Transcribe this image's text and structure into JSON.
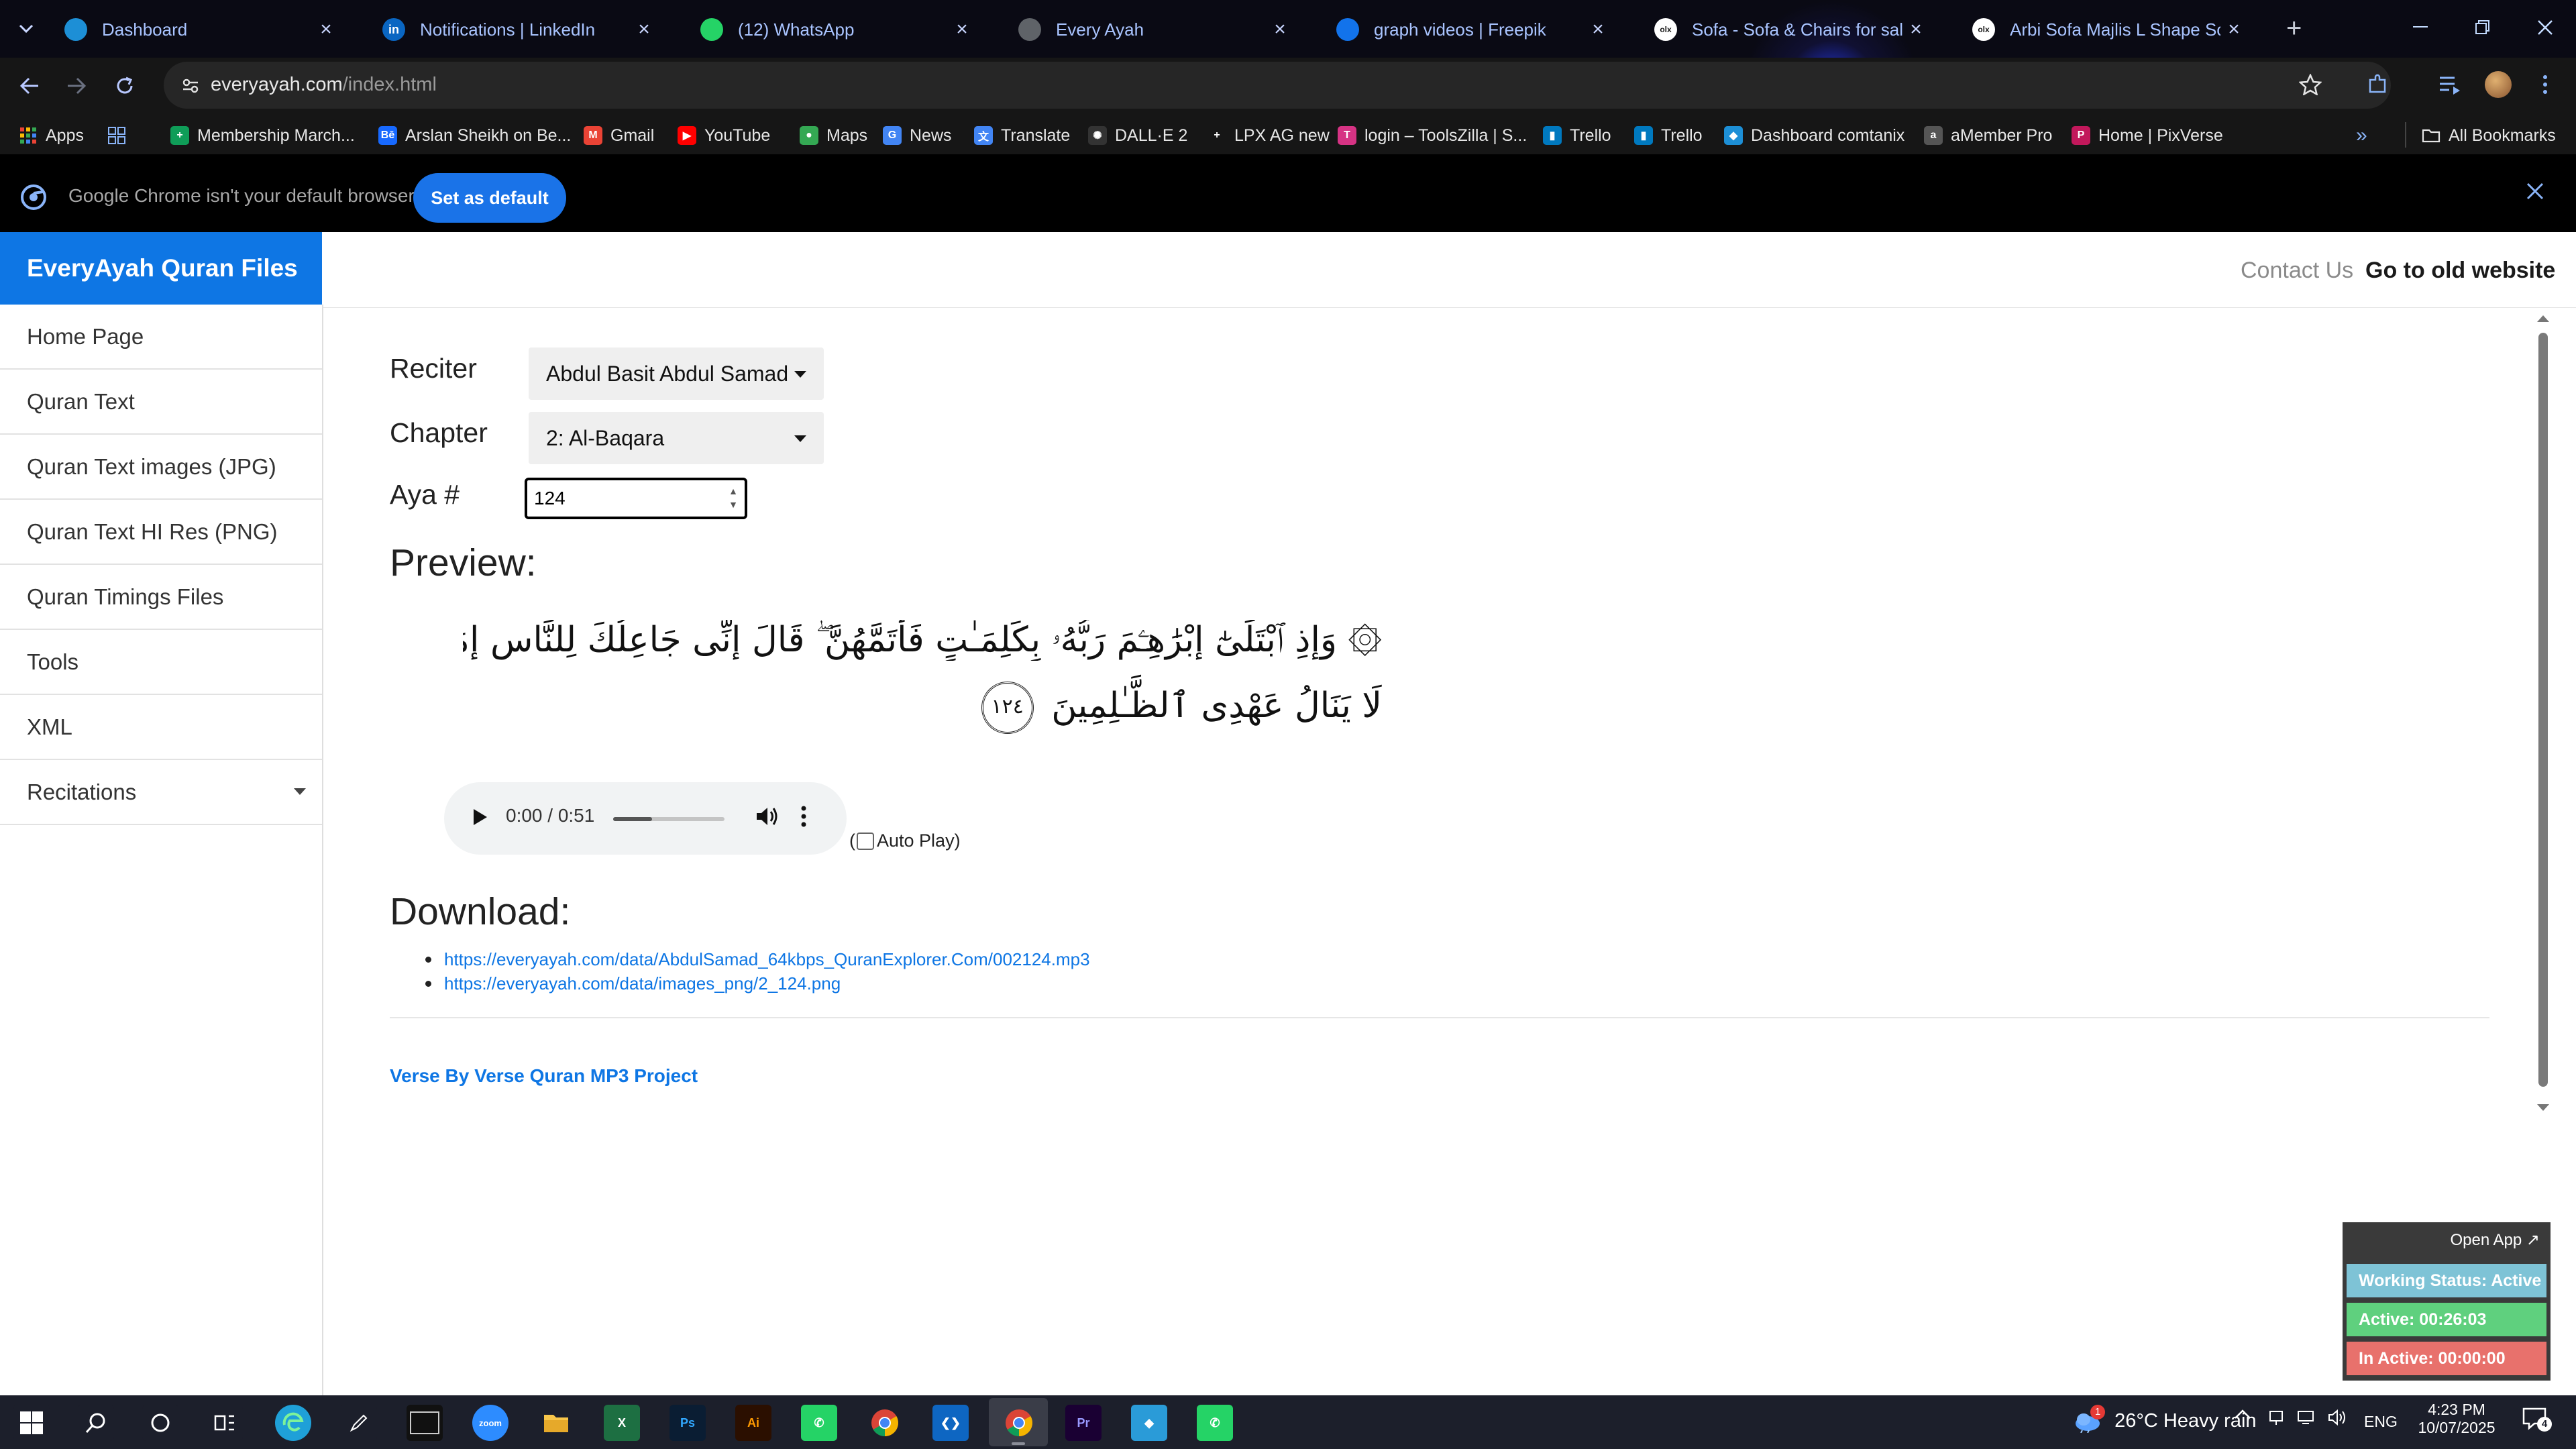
{
  "browser": {
    "tabs": [
      {
        "title": "Dashboard",
        "icon": "dashboard-favicon",
        "color": "#1d8fd6"
      },
      {
        "title": "Notifications | LinkedIn",
        "icon": "linkedin-favicon",
        "color": "#0a66c2",
        "glyph": "in"
      },
      {
        "title": "(12) WhatsApp",
        "icon": "whatsapp-favicon",
        "color": "#25d366"
      },
      {
        "title": "Every Ayah",
        "icon": "globe-favicon",
        "color": "#5f6368"
      },
      {
        "title": "graph videos | Freepik",
        "icon": "freepik-favicon",
        "color": "#1273eb"
      },
      {
        "title": "Sofa - Sofa & Chairs for sale in",
        "icon": "olx-favicon",
        "color": "#ffffff",
        "glyph": "olx"
      },
      {
        "title": "Arbi Sofa Majlis L Shape Sofa -",
        "icon": "olx-favicon",
        "color": "#ffffff",
        "glyph": "olx"
      }
    ],
    "url_host": "everyayah.com",
    "url_path": "/index.html",
    "bookmarks": [
      {
        "label": "Apps",
        "icon": "apps-grid-icon",
        "color": "#4285f4"
      },
      {
        "label": "",
        "icon": "tab-groups-icon",
        "color": "#8ab4f8"
      },
      {
        "label": "Membership March...",
        "icon": "plus-square-icon",
        "color": "#0f9d58"
      },
      {
        "label": "Arslan Sheikh on Be...",
        "icon": "behance-icon",
        "color": "#1769ff",
        "glyph": "Bē"
      },
      {
        "label": "Gmail",
        "icon": "gmail-icon",
        "color": "#ea4335",
        "glyph": "M"
      },
      {
        "label": "YouTube",
        "icon": "youtube-icon",
        "color": "#ff0000",
        "glyph": "▶"
      },
      {
        "label": "Maps",
        "icon": "maps-icon",
        "color": "#34a853",
        "glyph": "●"
      },
      {
        "label": "News",
        "icon": "news-icon",
        "color": "#4285f4",
        "glyph": "G"
      },
      {
        "label": "Translate",
        "icon": "translate-icon",
        "color": "#4285f4",
        "glyph": "文"
      },
      {
        "label": "DALL·E 2",
        "icon": "openai-icon",
        "color": "#333333",
        "glyph": "✺"
      },
      {
        "label": "LPX AG new",
        "icon": "blank-icon",
        "color": "#161616",
        "glyph": ""
      },
      {
        "label": "login – ToolsZilla | S...",
        "icon": "toolszilla-icon",
        "color": "#d63384",
        "glyph": "T"
      },
      {
        "label": "Trello",
        "icon": "trello-icon",
        "color": "#0079bf",
        "glyph": "▮"
      },
      {
        "label": "Trello",
        "icon": "trello-icon",
        "color": "#0079bf",
        "glyph": "▮"
      },
      {
        "label": "Dashboard comtanix",
        "icon": "dashboard-favicon",
        "color": "#1d8fd6",
        "glyph": "◆"
      },
      {
        "label": "aMember Pro",
        "icon": "amember-icon",
        "color": "#555555",
        "glyph": "a"
      },
      {
        "label": "Home | PixVerse",
        "icon": "pixverse-icon",
        "color": "#c2185b",
        "glyph": "P"
      }
    ],
    "bookmarks_overflow": "»",
    "all_bookmarks": "All Bookmarks",
    "infobar_text": "Google Chrome isn't your default browser",
    "infobar_button": "Set as default"
  },
  "site": {
    "brand": "EveryAyah Quran Files",
    "nav": {
      "contact": "Contact Us",
      "old_site": "Go to old website"
    },
    "sidebar": [
      {
        "label": "Home Page"
      },
      {
        "label": "Quran Text"
      },
      {
        "label": "Quran Text images (JPG)"
      },
      {
        "label": "Quran Text HI Res (PNG)"
      },
      {
        "label": "Quran Timings Files"
      },
      {
        "label": "Tools"
      },
      {
        "label": "XML"
      },
      {
        "label": "Recitations",
        "dropdown": true
      }
    ],
    "form": {
      "reciter_label": "Reciter",
      "reciter_value": "Abdul Basit Abdul Samad",
      "chapter_label": "Chapter",
      "chapter_value": "2: Al-Baqara",
      "aya_label": "Aya #",
      "aya_value": "124"
    },
    "preview_heading": "Preview:",
    "verse_line1": "۞ وَإِذِ ٱبْتَلَىٰٓ إِبْرَٰهِـۧمَ رَبُّهُۥ بِكَلِمَـٰتٍ فَأَتَمَّهُنَّ ۖ قَالَ إِنِّى جَاعِلُكَ لِلنَّاسِ إِمَامًا ۖ قَالَ وَمِن ذُرِّيَّتِى ۖ قَالَ",
    "verse_line2": "لَا يَنَالُ عَهْدِى ٱلظَّـٰلِمِينَ",
    "verse_number": "١٢٤",
    "audio": {
      "time": "0:00 / 0:51",
      "progress": 0.0
    },
    "autoplay_open": "(",
    "autoplay_label": "Auto Play)",
    "download_heading": "Download:",
    "downloads": [
      "https://everyayah.com/data/AbdulSamad_64kbps_QuranExplorer.Com/002124.mp3",
      "https://everyayah.com/data/images_png/2_124.png"
    ],
    "footer": "Verse By Verse Quran MP3 Project"
  },
  "widget": {
    "open": "Open App ↗",
    "status": "Working Status: Active",
    "active": "Active: 00:26:03",
    "inactive": "In Active: 00:00:00",
    "colors": {
      "status": "#7ec3d6",
      "active": "#5fd07e",
      "inactive": "#e8716c"
    }
  },
  "taskbar": {
    "apps": [
      {
        "icon": "windows-start-icon",
        "color": "#1c1f2b"
      },
      {
        "icon": "search-icon",
        "color": "#1c1f2b"
      },
      {
        "icon": "cortana-icon",
        "color": "#1c1f2b"
      },
      {
        "icon": "task-view-icon",
        "color": "#1c1f2b"
      },
      {
        "icon": "edge-icon",
        "color": "#1fa0d8"
      },
      {
        "icon": "pen-icon",
        "color": "#1c1f2b"
      },
      {
        "icon": "terminal-icon",
        "color": "#111111"
      },
      {
        "icon": "zoom-icon",
        "color": "#2d8cff",
        "glyph": "zoom"
      },
      {
        "icon": "file-explorer-icon",
        "color": "#f5c242"
      },
      {
        "icon": "excel-icon",
        "color": "#1d6f42",
        "glyph": "X"
      },
      {
        "icon": "photoshop-icon",
        "color": "#0a1d33",
        "glyph": "Ps"
      },
      {
        "icon": "illustrator-icon",
        "color": "#2b0f00",
        "glyph": "Ai"
      },
      {
        "icon": "whatsapp-business-icon",
        "color": "#25d366",
        "glyph": "✆"
      },
      {
        "icon": "chrome-icon",
        "color": "#ea4335"
      },
      {
        "icon": "vscode-icon",
        "color": "#0e66c2",
        "glyph": "❮❯"
      },
      {
        "icon": "chrome-active-icon",
        "color": "#ea4335"
      },
      {
        "icon": "premiere-icon",
        "color": "#1a0033",
        "glyph": "Pr"
      },
      {
        "icon": "app-icon",
        "color": "#2a9bd8",
        "glyph": "◆"
      },
      {
        "icon": "whatsapp-icon",
        "color": "#25d366",
        "glyph": "✆"
      }
    ],
    "weather": "26°C  Heavy rain",
    "weather_badge": "1",
    "lang": "ENG",
    "time": "4:23 PM",
    "date": "10/07/2025",
    "notifications": "4"
  }
}
